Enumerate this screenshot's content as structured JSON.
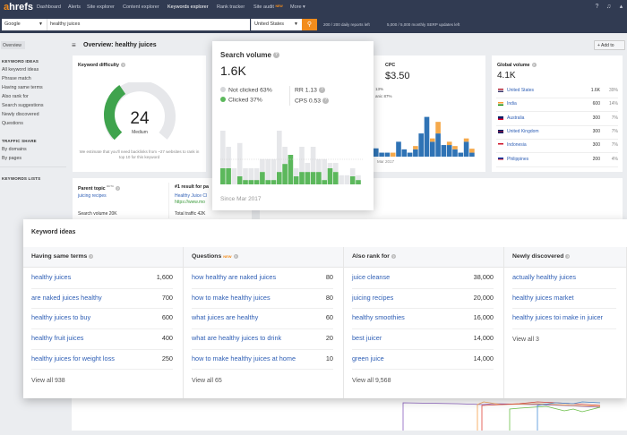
{
  "nav": {
    "logo_a": "a",
    "logo_rest": "hrefs",
    "items": [
      "Dashboard",
      "Alerts",
      "Site explorer",
      "Content explorer",
      "Keywords explorer",
      "Rank tracker",
      "Site audit",
      "More ▾"
    ],
    "new_badge": "NEW",
    "active": "Keywords explorer"
  },
  "search": {
    "engine": "Google",
    "query": "healthy juices",
    "country": "United States",
    "go_icon": "search-icon",
    "daily": "200 / 200 daily reports left",
    "monthly": "5,000 / 5,000 monthly SERP updates left"
  },
  "sidebar": {
    "overview": "Overview",
    "sections": [
      {
        "title": "KEYWORD IDEAS",
        "items": [
          "All keyword ideas",
          "Phrase match",
          "Having same terms",
          "Also rank for",
          "Search suggestions",
          "Newly discovered",
          "Questions"
        ]
      },
      {
        "title": "TRAFFIC SHARE",
        "items": [
          "By domains",
          "By pages"
        ]
      },
      {
        "title": "KEYWORDS LISTS",
        "items": []
      }
    ]
  },
  "page": {
    "title": "Overview: healthy juices",
    "add_to": "+ Add to"
  },
  "kd": {
    "title": "Keyword difficulty",
    "value": "24",
    "score": 24,
    "label": "Medium",
    "note": "We estimate that you'll need backlinks from ~27 websites to rank in top 10 for this keyword"
  },
  "parent": {
    "title": "Parent topic",
    "beta": "BETA",
    "topic": "juicing recipes",
    "volume": "Search volume 20K",
    "result_title": "#1 result for pa",
    "result_link": "Healthy Juice Cl",
    "result_url": "https://www.mo",
    "traffic": "Total traffic 42K"
  },
  "cpc": {
    "title": "CPC",
    "value": "$3.50",
    "paid": "13%",
    "organic": "anic 87%",
    "since": "Mar 2017",
    "bars": [
      {
        "b": 25,
        "o": 0
      },
      {
        "b": 12,
        "o": 0
      },
      {
        "b": 12,
        "o": 0
      },
      {
        "b": 0,
        "o": 12
      },
      {
        "b": 45,
        "o": 0
      },
      {
        "b": 22,
        "o": 0
      },
      {
        "b": 12,
        "o": 0
      },
      {
        "b": 22,
        "o": 10
      },
      {
        "b": 70,
        "o": 0
      },
      {
        "b": 120,
        "o": 0
      },
      {
        "b": 45,
        "o": 10
      },
      {
        "b": 70,
        "o": 35
      },
      {
        "b": 35,
        "o": 0
      },
      {
        "b": 35,
        "o": 10
      },
      {
        "b": 22,
        "o": 10
      },
      {
        "b": 12,
        "o": 0
      },
      {
        "b": 45,
        "o": 10
      },
      {
        "b": 12,
        "o": 12
      }
    ]
  },
  "gv": {
    "title": "Global volume",
    "value": "4.1K",
    "rows": [
      {
        "country": "United States",
        "vol": "1.6K",
        "pct": "39%",
        "flag": [
          "#b22234",
          "#fff",
          "#3c3b6e"
        ]
      },
      {
        "country": "India",
        "vol": "600",
        "pct": "14%",
        "flag": [
          "#ff9933",
          "#fff",
          "#138808"
        ]
      },
      {
        "country": "Australia",
        "vol": "300",
        "pct": "7%",
        "flag": [
          "#012169",
          "#012169",
          "#e4002b"
        ]
      },
      {
        "country": "United Kingdom",
        "vol": "300",
        "pct": "7%",
        "flag": [
          "#012169",
          "#c8102e",
          "#012169"
        ]
      },
      {
        "country": "Indonesia",
        "vol": "300",
        "pct": "7%",
        "flag": [
          "#ce1126",
          "#fff",
          "#fff"
        ]
      },
      {
        "country": "Philippines",
        "vol": "200",
        "pct": "4%",
        "flag": [
          "#0038a8",
          "#ce1126",
          "#fff"
        ]
      }
    ]
  },
  "sv": {
    "title": "Search volume",
    "value": "1.6K",
    "not_clicked": "Not clicked 63%",
    "clicked": "Clicked 37%",
    "rr": "RR 1.13",
    "cps": "CPS 0.53",
    "since": "Since Mar 2017",
    "colors": {
      "clicked": "#5cb85c",
      "not_clicked": "#e6e7ea"
    },
    "bars": [
      {
        "t": 100,
        "c": 30
      },
      {
        "t": 70,
        "c": 30
      },
      {
        "t": 30,
        "c": 0
      },
      {
        "t": 77,
        "c": 15
      },
      {
        "t": 30,
        "c": 8
      },
      {
        "t": 30,
        "c": 8
      },
      {
        "t": 30,
        "c": 8
      },
      {
        "t": 47,
        "c": 23
      },
      {
        "t": 47,
        "c": 8
      },
      {
        "t": 47,
        "c": 8
      },
      {
        "t": 100,
        "c": 23
      },
      {
        "t": 70,
        "c": 38
      },
      {
        "t": 40,
        "c": 55
      },
      {
        "t": 30,
        "c": 15
      },
      {
        "t": 70,
        "c": 23
      },
      {
        "t": 40,
        "c": 23
      },
      {
        "t": 70,
        "c": 23
      },
      {
        "t": 47,
        "c": 23
      },
      {
        "t": 47,
        "c": 8
      },
      {
        "t": 40,
        "c": 30
      },
      {
        "t": 40,
        "c": 23
      },
      {
        "t": 17,
        "c": 0
      },
      {
        "t": 17,
        "c": 0
      },
      {
        "t": 30,
        "c": 15
      },
      {
        "t": 17,
        "c": 8
      }
    ]
  },
  "ki": {
    "title": "Keyword ideas",
    "columns": [
      {
        "title": "Having same terms",
        "badge": "",
        "rows": [
          {
            "k": "healthy juices",
            "n": "1,600"
          },
          {
            "k": "are naked juices healthy",
            "n": "700"
          },
          {
            "k": "healthy juices to buy",
            "n": "600"
          },
          {
            "k": "healthy fruit juices",
            "n": "400"
          },
          {
            "k": "healthy juices for weight loss",
            "n": "250"
          }
        ],
        "view_all": "View all 938"
      },
      {
        "title": "Questions",
        "badge": "NEW",
        "rows": [
          {
            "k": "how healthy are naked juices",
            "n": "80"
          },
          {
            "k": "how to make healthy juices",
            "n": "80"
          },
          {
            "k": "what juices are healthy",
            "n": "60"
          },
          {
            "k": "what are healthy juices to drink",
            "n": "20"
          },
          {
            "k": "how to make healthy juices at home",
            "n": "10"
          }
        ],
        "view_all": "View all 65"
      },
      {
        "title": "Also rank for",
        "badge": "",
        "rows": [
          {
            "k": "juice cleanse",
            "n": "38,000"
          },
          {
            "k": "juicing recipes",
            "n": "20,000"
          },
          {
            "k": "healthy smoothies",
            "n": "16,000"
          },
          {
            "k": "best juicer",
            "n": "14,000"
          },
          {
            "k": "green juice",
            "n": "14,000"
          }
        ],
        "view_all": "View all 9,568"
      },
      {
        "title": "Newly discovered",
        "badge": "",
        "rows": [
          {
            "k": "actually healthy juices",
            "n": ""
          },
          {
            "k": "healthy juices market",
            "n": ""
          },
          {
            "k": "healthy juices toi make in juicer",
            "n": ""
          }
        ],
        "view_all": "View all 3"
      }
    ]
  }
}
